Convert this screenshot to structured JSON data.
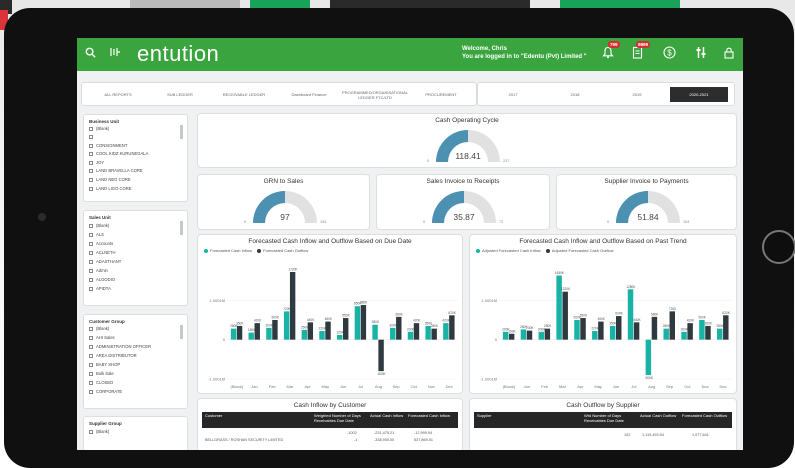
{
  "app": {
    "brand": "entution",
    "welcome_line1": "Welcome, Chris",
    "welcome_line2": "You are logged in to \"Edentu (Pvt) Limited \"",
    "badges": {
      "notifications": "799",
      "documents": "9899"
    }
  },
  "filters": [
    {
      "label": "ALL REPORTS"
    },
    {
      "label": "SUB LEDGER"
    },
    {
      "label": "RECEIVABLE LEDGER"
    },
    {
      "label": "Dashboard Finance"
    },
    {
      "label": "PROGRAMMED/ORGANISATIONAL\nLEDGER FTC/LTD"
    },
    {
      "label": "PROCUREMENT"
    }
  ],
  "years": [
    "2017",
    "2018",
    "2019",
    "2020-2021"
  ],
  "selected_year_index": 3,
  "panels": {
    "business_unit": {
      "title": "Business Unit",
      "items": [
        "(Blank)",
        "",
        "CONSIGNMENT",
        "COOL KIDZ KURUNEGALA",
        "JOY",
        "LAND BRAVELLA CORE",
        "LAND NEO CORE",
        "LAND LIGO CORE"
      ]
    },
    "sales_unit": {
      "title": "Sales Unit",
      "items": [
        "(Blank)",
        "ALS",
        "Accounts",
        "ACLNETH",
        "ADASTHANT",
        "Admin",
        "ALGODIO",
        "APIDTA"
      ]
    },
    "customer_group": {
      "title": "Customer Group",
      "items": [
        "(Blank)",
        "AHI Sales",
        "ADMINISTRATION OFFICER",
        "AREA DISTRIBUTOR",
        "BABY SHOP",
        "Bulk Sale",
        "CLOSED",
        "CORPORATE"
      ]
    },
    "supplier_group": {
      "title": "Supplier Group",
      "items": [
        "(Blank)"
      ]
    }
  },
  "gauges": {
    "cash_operating_cycle": {
      "title": "Cash Operating Cycle",
      "value": "118.41",
      "min": "0",
      "max": "237",
      "fraction": 0.5
    },
    "grn_to_sales": {
      "title": "GRN to Sales",
      "value": "97",
      "min": "0",
      "max": "194",
      "fraction": 0.5
    },
    "sales_invoice_to_receipts": {
      "title": "Sales Invoice to Receipts",
      "value": "35.87",
      "min": "0",
      "max": "72",
      "fraction": 0.5
    },
    "supplier_invoice_to_payments": {
      "title": "Supplier Invoice to Payments",
      "value": "51.84",
      "min": "0",
      "max": "104",
      "fraction": 0.5
    }
  },
  "charts": {
    "due_date": {
      "title": "Forecasted Cash Inflow and Outflow Based on Due Date",
      "legend": [
        "Forecasted Cash Inflow",
        "Forecasted Cash Outflow"
      ],
      "y_ticks": [
        "1.0001M",
        "0",
        "-1.0001M"
      ],
      "colors": {
        "inflow": "#19b3a6",
        "outflow": "#2f3a40"
      }
    },
    "past_trend": {
      "title": "Forecasted Cash Inflow and Outflow Based on Past Trend",
      "legend": [
        "Adjusted Forecasted Cash Inflow",
        "Adjusted Forecasted Cash Outflow"
      ],
      "y_ticks": [
        "1.0001M",
        "0",
        "-1.0001M"
      ],
      "colors": {
        "inflow": "#19b3a6",
        "outflow": "#2f3a40"
      }
    }
  },
  "chart_data": [
    {
      "type": "bar",
      "title": "Forecasted Cash Inflow and Outflow Based on Due Date",
      "categories": [
        "(Blank)",
        "Jan",
        "Feb",
        "Mar",
        "Apr",
        "May",
        "Jun",
        "Jul",
        "Aug",
        "Sep",
        "Oct",
        "Nov",
        "Dec"
      ],
      "series": [
        {
          "name": "Forecasted Cash Inflow",
          "values": [
            0.28,
            0.18,
            0.3,
            0.72,
            0.25,
            0.22,
            0.12,
            0.85,
            0.38,
            0.3,
            0.2,
            0.35,
            0.42
          ]
        },
        {
          "name": "Forecasted Cash Outflow",
          "values": [
            0.35,
            0.42,
            0.5,
            1.72,
            0.44,
            0.46,
            0.55,
            0.88,
            -0.8,
            0.58,
            0.42,
            0.28,
            0.62
          ]
        }
      ],
      "ylim": [
        -1.0,
        2.0
      ]
    },
    {
      "type": "bar",
      "title": "Forecasted Cash Inflow and Outflow Based on Past Trend",
      "categories": [
        "(Blank)",
        "Jan",
        "Feb",
        "Mar",
        "Apr",
        "May",
        "Jun",
        "Jul",
        "Aug",
        "Sep",
        "Oct",
        "Nov",
        "Dec"
      ],
      "series": [
        {
          "name": "Adjusted Forecasted Cash Inflow",
          "values": [
            0.2,
            0.26,
            0.2,
            1.63,
            0.5,
            0.22,
            0.35,
            1.28,
            -0.9,
            0.28,
            0.2,
            0.5,
            0.28
          ]
        },
        {
          "name": "Adjusted Forecasted Cash Outflow",
          "values": [
            0.15,
            0.23,
            0.28,
            1.22,
            0.55,
            0.46,
            0.6,
            0.44,
            0.58,
            0.72,
            0.42,
            0.35,
            0.62
          ]
        }
      ],
      "ylim": [
        -1.0,
        2.0
      ]
    }
  ],
  "tables": {
    "inflow_by_customer": {
      "title": "Cash Inflow by Customer",
      "columns": [
        "Customer",
        "Weighted Number of Days Receivables Due Date",
        "Actual Cash Inflow",
        "Forecasted Cash Inflow"
      ],
      "rows": [
        [
          "",
          "-1002",
          "-231,475.21",
          "-12,999.94"
        ],
        [
          "BELLGRASS / ROSHAN SECURITY LIMITED",
          "-1",
          "-338,900.00",
          "537,869.51"
        ]
      ]
    },
    "outflow_by_supplier": {
      "title": "Cash Outflow by Supplier",
      "columns": [
        "Supplier",
        "Wtd Number of Days Receivables Due Date",
        "Actual Cash Outflow",
        "Forecasted Cash Outflow"
      ],
      "rows": [
        [
          "",
          "102",
          "1,119,493.54",
          "1,077,641"
        ]
      ]
    }
  }
}
